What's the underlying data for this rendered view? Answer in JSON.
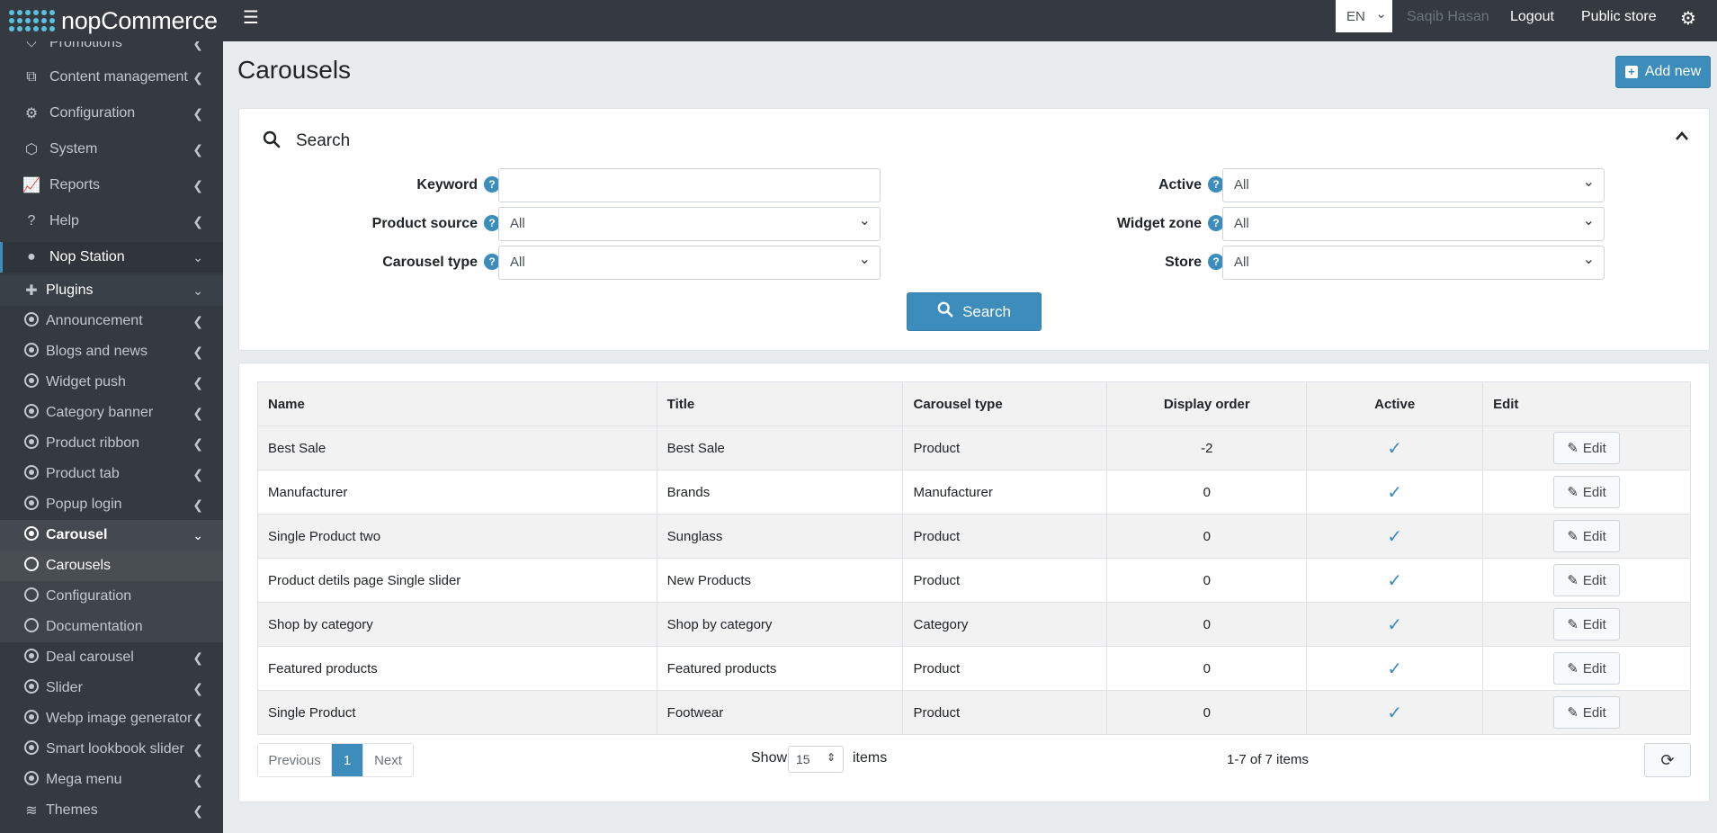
{
  "header": {
    "logo_text": "nopCommerce",
    "menu_icon": "hamburger-icon",
    "language": "EN",
    "user_name": "Saqib Hasan",
    "logout": "Logout",
    "public_store": "Public store",
    "settings_icon": "gears-icon"
  },
  "sidebar": {
    "items": [
      {
        "label": "Promotions",
        "icon": "tag-icon"
      },
      {
        "label": "Content management",
        "icon": "cubes-icon"
      },
      {
        "label": "Configuration",
        "icon": "gears-icon"
      },
      {
        "label": "System",
        "icon": "cube-icon"
      },
      {
        "label": "Reports",
        "icon": "line-chart-icon"
      },
      {
        "label": "Help",
        "icon": "question-icon"
      },
      {
        "label": "Nop Station",
        "icon": "cookie-icon"
      },
      {
        "label": "Plugins",
        "icon": "puzzle-icon"
      }
    ],
    "plugins": [
      {
        "label": "Announcement"
      },
      {
        "label": "Blogs and news"
      },
      {
        "label": "Widget push"
      },
      {
        "label": "Category banner"
      },
      {
        "label": "Product ribbon"
      },
      {
        "label": "Product tab"
      },
      {
        "label": "Popup login"
      },
      {
        "label": "Carousel"
      }
    ],
    "carousel_children": [
      {
        "label": "Carousels"
      },
      {
        "label": "Configuration"
      },
      {
        "label": "Documentation"
      }
    ],
    "more_plugins": [
      {
        "label": "Deal carousel"
      },
      {
        "label": "Slider"
      },
      {
        "label": "Webp image generator"
      },
      {
        "label": "Smart lookbook slider"
      },
      {
        "label": "Mega menu"
      }
    ],
    "themes": {
      "label": "Themes",
      "icon": "layers-icon"
    }
  },
  "page": {
    "title": "Carousels",
    "add_new": "Add new"
  },
  "search": {
    "title": "Search",
    "keyword_label": "Keyword",
    "keyword_value": "",
    "product_source_label": "Product source",
    "product_source_value": "All",
    "carousel_type_label": "Carousel type",
    "carousel_type_value": "All",
    "active_label": "Active",
    "active_value": "All",
    "widget_zone_label": "Widget zone",
    "widget_zone_value": "All",
    "store_label": "Store",
    "store_value": "All",
    "help_glyph": "?",
    "button": "Search"
  },
  "table": {
    "columns": [
      "Name",
      "Title",
      "Carousel type",
      "Display order",
      "Active",
      "Edit"
    ],
    "edit_label": "Edit",
    "rows": [
      {
        "name": "Best Sale",
        "title": "Best Sale",
        "type": "Product",
        "order": "-2",
        "active": true
      },
      {
        "name": "Manufacturer",
        "title": "Brands",
        "type": "Manufacturer",
        "order": "0",
        "active": true
      },
      {
        "name": "Single Product two",
        "title": "Sunglass",
        "type": "Product",
        "order": "0",
        "active": true
      },
      {
        "name": "Product detils page Single slider",
        "title": "New Products",
        "type": "Product",
        "order": "0",
        "active": true
      },
      {
        "name": "Shop by category",
        "title": "Shop by category",
        "type": "Category",
        "order": "0",
        "active": true
      },
      {
        "name": "Featured products",
        "title": "Featured products",
        "type": "Product",
        "order": "0",
        "active": true
      },
      {
        "name": "Single Product",
        "title": "Footwear",
        "type": "Product",
        "order": "0",
        "active": true
      }
    ]
  },
  "pager": {
    "previous": "Previous",
    "current": "1",
    "next": "Next",
    "show": "Show",
    "page_size": "15",
    "items": "items",
    "count": "1-7 of 7 items"
  },
  "colors": {
    "accent": "#3c8dbc",
    "sidebar_bg": "#343a40",
    "page_bg": "#e9ecef"
  }
}
